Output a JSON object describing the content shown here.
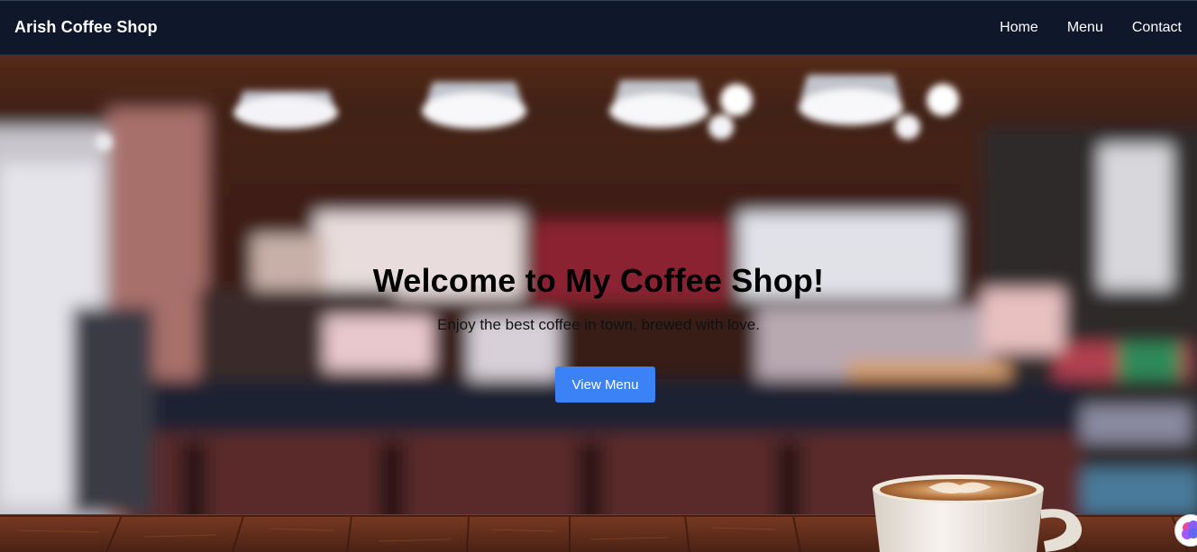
{
  "navbar": {
    "brand": "Arish Coffee Shop",
    "links": [
      {
        "label": "Home"
      },
      {
        "label": "Menu"
      },
      {
        "label": "Contact"
      }
    ]
  },
  "hero": {
    "title": "Welcome to My Coffee Shop!",
    "subtitle": "Enjoy the best coffee in town, brewed with love.",
    "cta_label": "View Menu",
    "background": "blurred-coffee-shop-interior-photo"
  },
  "colors": {
    "navbar_bg": "#0f172a",
    "cta_bg": "#3b82f6",
    "title_text": "#000000"
  },
  "icons": {
    "floating_badge": "colorful-brain-icon"
  }
}
